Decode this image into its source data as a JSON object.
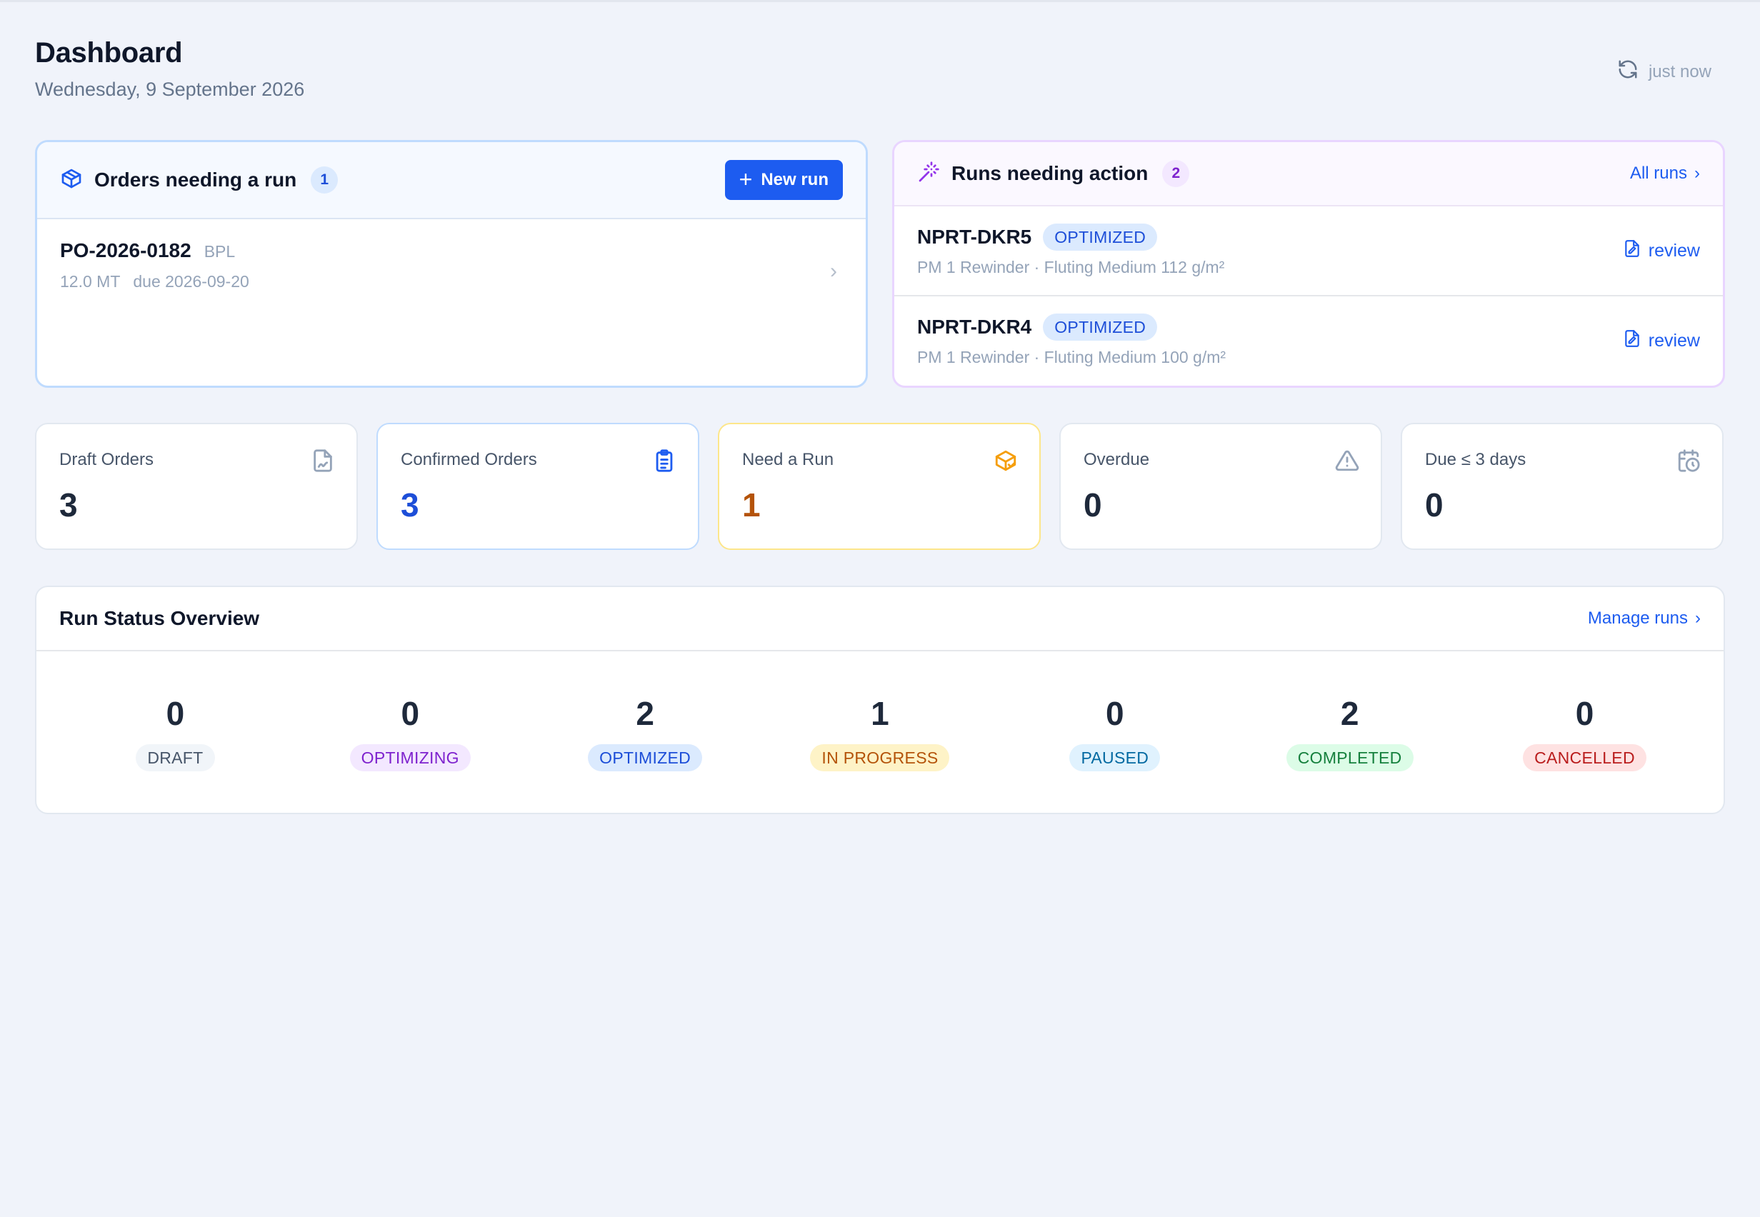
{
  "header": {
    "title": "Dashboard",
    "date": "Wednesday, 9 September 2026",
    "refresh_label": "just now"
  },
  "orders_panel": {
    "title": "Orders needing a run",
    "count": "1",
    "new_run_label": "New run",
    "orders": [
      {
        "id": "PO-2026-0182",
        "customer": "BPL",
        "quantity": "12.0 MT",
        "due": "due 2026-09-20"
      }
    ]
  },
  "runs_panel": {
    "title": "Runs needing action",
    "count": "2",
    "all_runs_label": "All runs",
    "runs": [
      {
        "id": "NPRT-DKR5",
        "status": "OPTIMIZED",
        "detail": "PM 1 Rewinder · Fluting Medium 112 g/m²",
        "action": "review"
      },
      {
        "id": "NPRT-DKR4",
        "status": "OPTIMIZED",
        "detail": "PM 1 Rewinder · Fluting Medium 100 g/m²",
        "action": "review"
      }
    ]
  },
  "stats": [
    {
      "label": "Draft Orders",
      "value": "3",
      "icon": "file-signature-icon"
    },
    {
      "label": "Confirmed Orders",
      "value": "3",
      "icon": "clipboard-list-icon"
    },
    {
      "label": "Need a Run",
      "value": "1",
      "icon": "package-check-icon"
    },
    {
      "label": "Overdue",
      "value": "0",
      "icon": "warning-triangle-icon"
    },
    {
      "label": "Due ≤ 3 days",
      "value": "0",
      "icon": "calendar-clock-icon"
    }
  ],
  "overview": {
    "title": "Run Status Overview",
    "manage_label": "Manage runs",
    "statuses": [
      {
        "count": "0",
        "label": "DRAFT"
      },
      {
        "count": "0",
        "label": "OPTIMIZING"
      },
      {
        "count": "2",
        "label": "OPTIMIZED"
      },
      {
        "count": "1",
        "label": "IN PROGRESS"
      },
      {
        "count": "0",
        "label": "PAUSED"
      },
      {
        "count": "2",
        "label": "COMPLETED"
      },
      {
        "count": "0",
        "label": "CANCELLED"
      }
    ]
  },
  "colors": {
    "background": "#f0f3fa",
    "accent": "#1d5cf0",
    "orders_border": "#bfdbfe",
    "runs_border": "#e9d5ff",
    "amber": "#b45309"
  }
}
